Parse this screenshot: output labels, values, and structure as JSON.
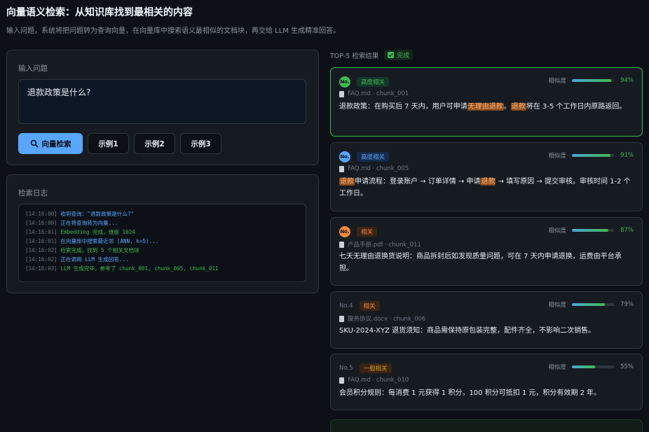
{
  "page": {
    "title": "向量语义检索：从知识库找到最相关的内容",
    "subtitle": "输入问题，系统将把问题转为查询向量，在向量库中搜索语义最相似的文档块，再交给 LLM 生成精准回答。"
  },
  "input_panel": {
    "label": "输入问题",
    "question": "退款政策是什么?",
    "search_button": "向量检索",
    "examples": [
      "示例1",
      "示例2",
      "示例3"
    ]
  },
  "log_panel": {
    "label": "检索日志",
    "lines": [
      {
        "ts": "[14:16:00]",
        "msg": "收到查询：\"退款政策是什么?\"",
        "color": "blue"
      },
      {
        "ts": "[14:16:00]",
        "msg": "正在将查询转为向量...",
        "color": "blue"
      },
      {
        "ts": "[14:16:01]",
        "msg": "Embedding 完成，维度 1024",
        "color": "green"
      },
      {
        "ts": "[14:16:01]",
        "msg": "在向量库中搜索最近邻 (ANN, k=5)...",
        "color": "blue"
      },
      {
        "ts": "[14:16:02]",
        "msg": "检索完成，找到 5 个相关文档块",
        "color": "green"
      },
      {
        "ts": "[14:16:02]",
        "msg": "正在调用 LLM 生成回答...",
        "color": "blue"
      },
      {
        "ts": "[14:16:03]",
        "msg": "LLM 生成完毕，参考了 chunk_001, chunk_005, chunk_011",
        "color": "green"
      }
    ]
  },
  "results": {
    "header": "TOP-5 检索结果",
    "status": "完成",
    "sim_label": "相似度",
    "items": [
      {
        "rank": "No.",
        "tag": "高度相关",
        "tag_style": "high",
        "source": "FAQ.md · chunk_001",
        "score": 0.94,
        "score_label": "94%",
        "segments": [
          {
            "t": "退款政策：在购买后 7 天内，用户可申请"
          },
          {
            "t": "无理由退款",
            "hl": true
          },
          {
            "t": "。"
          },
          {
            "t": "退款",
            "hl": true
          },
          {
            "t": "将在 3-5 个工作日内原路返回。"
          }
        ]
      },
      {
        "rank": "No.",
        "tag": "高度相关",
        "tag_style": "high-blue",
        "source": "FAQ.md · chunk_005",
        "score": 0.91,
        "score_label": "91%",
        "segments": [
          {
            "t": "退款",
            "hl": true
          },
          {
            "t": "申请流程：登录账户 → 订单详情 → 申请"
          },
          {
            "t": "退款",
            "hl": true
          },
          {
            "t": " → 填写原因 → 提交审核。审核时间 1-2 个工作日。"
          }
        ]
      },
      {
        "rank": "No.",
        "tag": "相关",
        "tag_style": "mid",
        "source": "产品手册.pdf · chunk_011",
        "score": 0.87,
        "score_label": "87%",
        "segments": [
          {
            "t": "七天无理由退换货说明：商品拆封后如发现质量问题，可在 7 天内申请退换，运费由平台承担。"
          }
        ]
      },
      {
        "rank": "No.4",
        "tag": "相关",
        "tag_style": "mid",
        "source": "服务协议.docx · chunk_006",
        "score": 0.79,
        "score_label": "79%",
        "segments": [
          {
            "t": "SKU-2024-XYZ 退货须知：商品需保持原包装完整，配件齐全，不影响二次销售。"
          }
        ]
      },
      {
        "rank": "No.5",
        "tag": "一般相关",
        "tag_style": "low",
        "source": "FAQ.md · chunk_010",
        "score": 0.55,
        "score_label": "55%",
        "segments": [
          {
            "t": "会员积分规则：每消费 1 元获得 1 积分，100 积分可抵扣 1 元，积分有效期 2 年。"
          }
        ]
      }
    ]
  },
  "colors": {
    "rank1": "#3fb950",
    "rank2": "#58a6ff",
    "rank3": "#f0883e",
    "accent": "#58a6ff"
  }
}
